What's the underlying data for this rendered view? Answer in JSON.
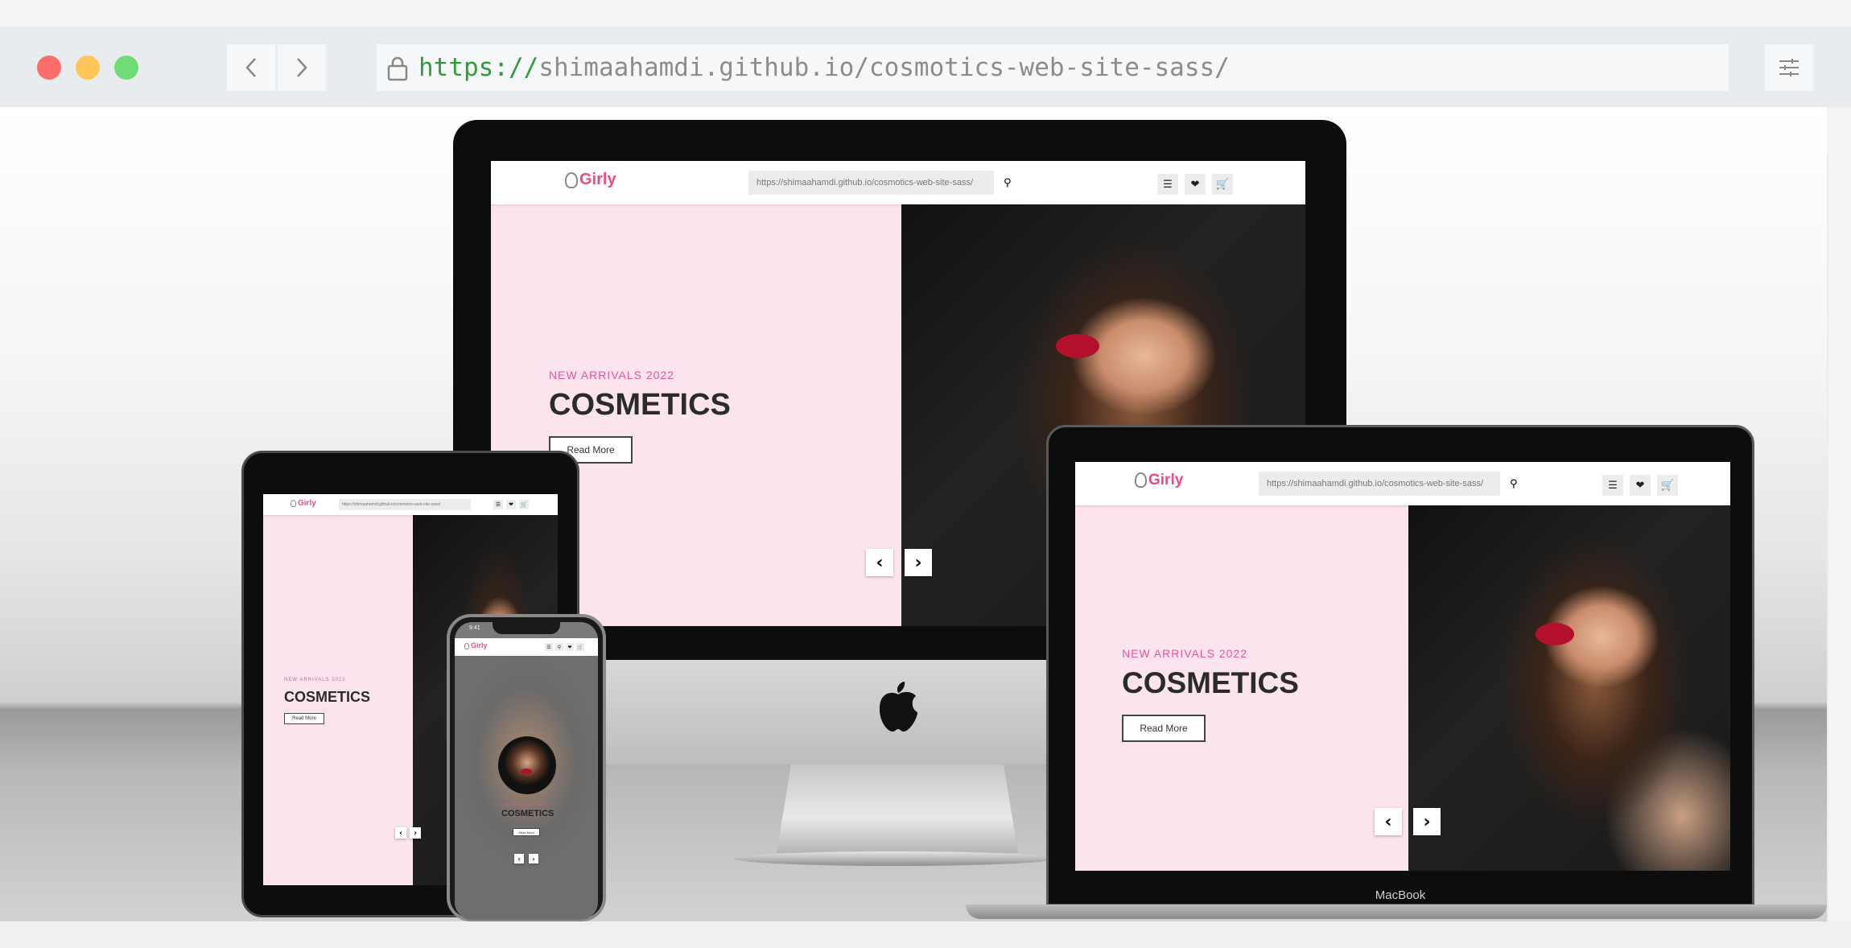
{
  "browser": {
    "url_scheme": "https://",
    "url_rest": "shimaahamdi.github.io/cosmotics-web-site-sass/"
  },
  "site": {
    "logo": "Girly",
    "search_value": "https://shimaahamdi.github.io/cosmotics-web-site-sass/",
    "hero_tag": "NEW ARRIVALS 2022",
    "hero_title": "COSMETICS",
    "read_more": "Read More",
    "prev_arrow": "‹",
    "next_arrow": "›"
  },
  "devices": {
    "laptop_brand": "MacBook",
    "phone_time": "9:41"
  },
  "colors": {
    "accent_pink": "#e8559a",
    "hero_bg": "#fce4ef"
  }
}
